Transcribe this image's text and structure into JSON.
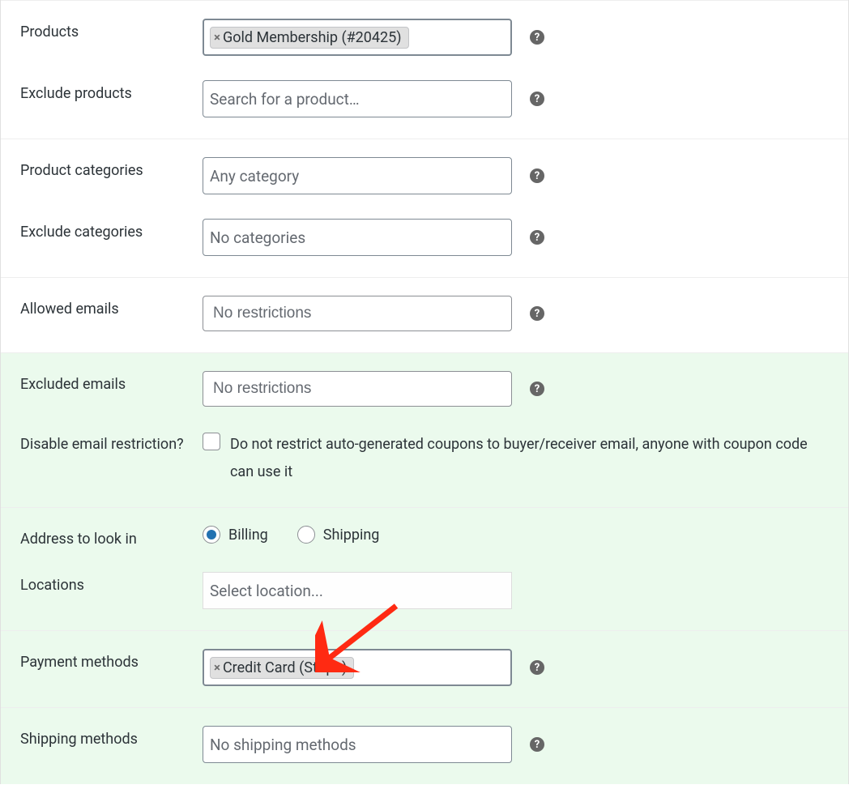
{
  "fields": {
    "products": {
      "label": "Products",
      "tag": "Gold Membership (#20425)"
    },
    "excludeProducts": {
      "label": "Exclude products",
      "placeholder": "Search for a product…"
    },
    "productCategories": {
      "label": "Product categories",
      "placeholder": "Any category"
    },
    "excludeCategories": {
      "label": "Exclude categories",
      "placeholder": "No categories"
    },
    "allowedEmails": {
      "label": "Allowed emails",
      "placeholder": "No restrictions"
    },
    "excludedEmails": {
      "label": "Excluded emails",
      "placeholder": "No restrictions"
    },
    "disableEmailRestriction": {
      "label": "Disable email restriction?",
      "description": "Do not restrict auto-generated coupons to buyer/receiver email, anyone with coupon code can use it"
    },
    "addressLookIn": {
      "label": "Address to look in",
      "options": {
        "billing": "Billing",
        "shipping": "Shipping"
      },
      "selected": "billing"
    },
    "locations": {
      "label": "Locations",
      "placeholder": "Select location..."
    },
    "paymentMethods": {
      "label": "Payment methods",
      "tag": "Credit Card (Stripe)"
    },
    "shippingMethods": {
      "label": "Shipping methods",
      "placeholder": "No shipping methods"
    }
  },
  "help": "?"
}
